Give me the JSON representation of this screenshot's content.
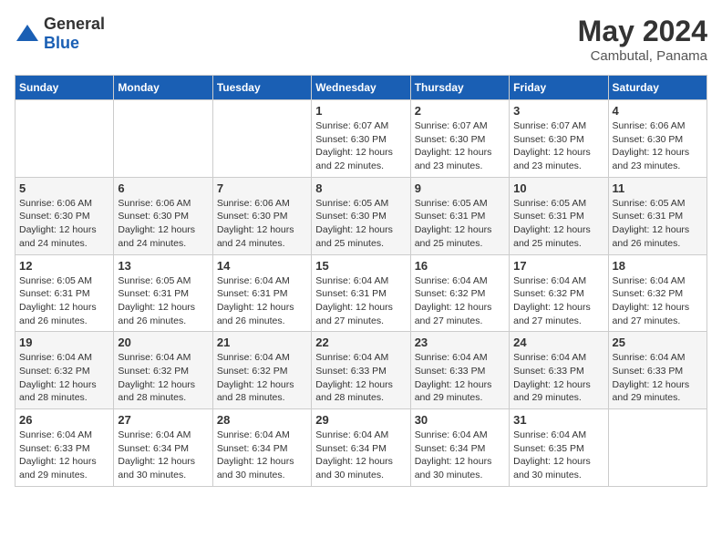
{
  "logo": {
    "general": "General",
    "blue": "Blue"
  },
  "title": "May 2024",
  "subtitle": "Cambutal, Panama",
  "headers": [
    "Sunday",
    "Monday",
    "Tuesday",
    "Wednesday",
    "Thursday",
    "Friday",
    "Saturday"
  ],
  "weeks": [
    [
      {
        "day": "",
        "info": ""
      },
      {
        "day": "",
        "info": ""
      },
      {
        "day": "",
        "info": ""
      },
      {
        "day": "1",
        "info": "Sunrise: 6:07 AM\nSunset: 6:30 PM\nDaylight: 12 hours\nand 22 minutes."
      },
      {
        "day": "2",
        "info": "Sunrise: 6:07 AM\nSunset: 6:30 PM\nDaylight: 12 hours\nand 23 minutes."
      },
      {
        "day": "3",
        "info": "Sunrise: 6:07 AM\nSunset: 6:30 PM\nDaylight: 12 hours\nand 23 minutes."
      },
      {
        "day": "4",
        "info": "Sunrise: 6:06 AM\nSunset: 6:30 PM\nDaylight: 12 hours\nand 23 minutes."
      }
    ],
    [
      {
        "day": "5",
        "info": "Sunrise: 6:06 AM\nSunset: 6:30 PM\nDaylight: 12 hours\nand 24 minutes."
      },
      {
        "day": "6",
        "info": "Sunrise: 6:06 AM\nSunset: 6:30 PM\nDaylight: 12 hours\nand 24 minutes."
      },
      {
        "day": "7",
        "info": "Sunrise: 6:06 AM\nSunset: 6:30 PM\nDaylight: 12 hours\nand 24 minutes."
      },
      {
        "day": "8",
        "info": "Sunrise: 6:05 AM\nSunset: 6:30 PM\nDaylight: 12 hours\nand 25 minutes."
      },
      {
        "day": "9",
        "info": "Sunrise: 6:05 AM\nSunset: 6:31 PM\nDaylight: 12 hours\nand 25 minutes."
      },
      {
        "day": "10",
        "info": "Sunrise: 6:05 AM\nSunset: 6:31 PM\nDaylight: 12 hours\nand 25 minutes."
      },
      {
        "day": "11",
        "info": "Sunrise: 6:05 AM\nSunset: 6:31 PM\nDaylight: 12 hours\nand 26 minutes."
      }
    ],
    [
      {
        "day": "12",
        "info": "Sunrise: 6:05 AM\nSunset: 6:31 PM\nDaylight: 12 hours\nand 26 minutes."
      },
      {
        "day": "13",
        "info": "Sunrise: 6:05 AM\nSunset: 6:31 PM\nDaylight: 12 hours\nand 26 minutes."
      },
      {
        "day": "14",
        "info": "Sunrise: 6:04 AM\nSunset: 6:31 PM\nDaylight: 12 hours\nand 26 minutes."
      },
      {
        "day": "15",
        "info": "Sunrise: 6:04 AM\nSunset: 6:31 PM\nDaylight: 12 hours\nand 27 minutes."
      },
      {
        "day": "16",
        "info": "Sunrise: 6:04 AM\nSunset: 6:32 PM\nDaylight: 12 hours\nand 27 minutes."
      },
      {
        "day": "17",
        "info": "Sunrise: 6:04 AM\nSunset: 6:32 PM\nDaylight: 12 hours\nand 27 minutes."
      },
      {
        "day": "18",
        "info": "Sunrise: 6:04 AM\nSunset: 6:32 PM\nDaylight: 12 hours\nand 27 minutes."
      }
    ],
    [
      {
        "day": "19",
        "info": "Sunrise: 6:04 AM\nSunset: 6:32 PM\nDaylight: 12 hours\nand 28 minutes."
      },
      {
        "day": "20",
        "info": "Sunrise: 6:04 AM\nSunset: 6:32 PM\nDaylight: 12 hours\nand 28 minutes."
      },
      {
        "day": "21",
        "info": "Sunrise: 6:04 AM\nSunset: 6:32 PM\nDaylight: 12 hours\nand 28 minutes."
      },
      {
        "day": "22",
        "info": "Sunrise: 6:04 AM\nSunset: 6:33 PM\nDaylight: 12 hours\nand 28 minutes."
      },
      {
        "day": "23",
        "info": "Sunrise: 6:04 AM\nSunset: 6:33 PM\nDaylight: 12 hours\nand 29 minutes."
      },
      {
        "day": "24",
        "info": "Sunrise: 6:04 AM\nSunset: 6:33 PM\nDaylight: 12 hours\nand 29 minutes."
      },
      {
        "day": "25",
        "info": "Sunrise: 6:04 AM\nSunset: 6:33 PM\nDaylight: 12 hours\nand 29 minutes."
      }
    ],
    [
      {
        "day": "26",
        "info": "Sunrise: 6:04 AM\nSunset: 6:33 PM\nDaylight: 12 hours\nand 29 minutes."
      },
      {
        "day": "27",
        "info": "Sunrise: 6:04 AM\nSunset: 6:34 PM\nDaylight: 12 hours\nand 30 minutes."
      },
      {
        "day": "28",
        "info": "Sunrise: 6:04 AM\nSunset: 6:34 PM\nDaylight: 12 hours\nand 30 minutes."
      },
      {
        "day": "29",
        "info": "Sunrise: 6:04 AM\nSunset: 6:34 PM\nDaylight: 12 hours\nand 30 minutes."
      },
      {
        "day": "30",
        "info": "Sunrise: 6:04 AM\nSunset: 6:34 PM\nDaylight: 12 hours\nand 30 minutes."
      },
      {
        "day": "31",
        "info": "Sunrise: 6:04 AM\nSunset: 6:35 PM\nDaylight: 12 hours\nand 30 minutes."
      },
      {
        "day": "",
        "info": ""
      }
    ]
  ]
}
